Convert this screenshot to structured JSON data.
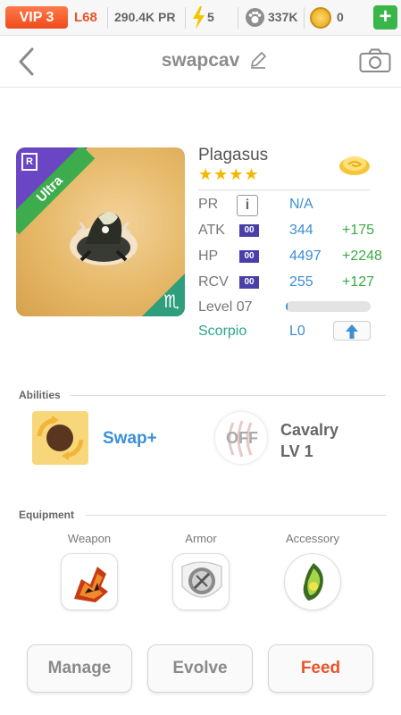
{
  "status_bar": {
    "vip": "VIP 3",
    "level": "L68",
    "power": "290.4K PR",
    "energy": "5",
    "paws": "337K",
    "coins": "0",
    "add": "+"
  },
  "header": {
    "title": "swapcav"
  },
  "monster": {
    "rarity_badge": "R",
    "rarity": "Ultra",
    "zodiac_symbol": "♏",
    "name": "Plagasus",
    "stars": "★★★★"
  },
  "stats": {
    "pr_label": "PR",
    "pr_info": "i",
    "pr_value": "N/A",
    "atk_label": "ATK",
    "atk_badge": "00",
    "atk_value": "344",
    "atk_bonus": "+175",
    "hp_label": "HP",
    "hp_badge": "00",
    "hp_value": "4497",
    "hp_bonus": "+2248",
    "rcv_label": "RCV",
    "rcv_badge": "00",
    "rcv_value": "255",
    "rcv_bonus": "+127",
    "level_label": "Level 07",
    "level_progress": 0.02,
    "zodiac_label": "Scorpio",
    "zodiac_level": "L0"
  },
  "abilities": {
    "title": "Abilities",
    "ability1": "Swap+",
    "ability2_state": "OFF",
    "ability2_name": "Cavalry",
    "ability2_level": "LV 1"
  },
  "equipment": {
    "title": "Equipment",
    "weapon": "Weapon",
    "armor": "Armor",
    "accessory": "Accessory"
  },
  "buttons": {
    "manage": "Manage",
    "evolve": "Evolve",
    "feed": "Feed"
  },
  "colors": {
    "accent_blue": "#3b8fd4",
    "accent_green": "#3aab45",
    "feed_orange": "#e8542a",
    "ultra_purple": "#6a45c4"
  }
}
